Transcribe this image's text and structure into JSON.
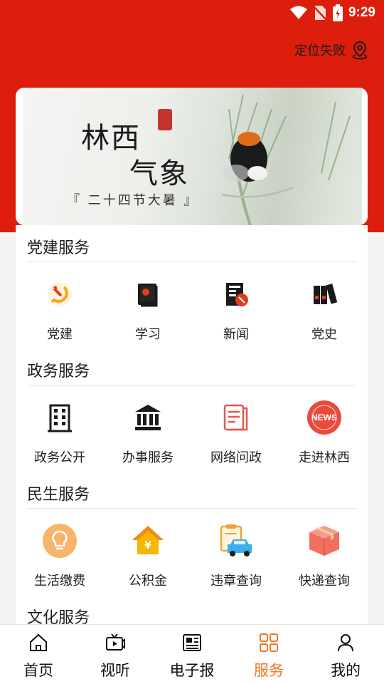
{
  "status_bar": {
    "time": "9:29"
  },
  "location": {
    "text": "定位失败",
    "icon": "location-pin-icon"
  },
  "banner": {
    "title_line1": "林西",
    "title_line2": "气象",
    "subtitle": "『 二十四节大暑 』"
  },
  "sections": [
    {
      "title": "党建服务",
      "items": [
        {
          "label": "党建",
          "icon": "hammer-sickle-icon"
        },
        {
          "label": "学习",
          "icon": "book-icon"
        },
        {
          "label": "新闻",
          "icon": "news-doc-icon"
        },
        {
          "label": "党史",
          "icon": "binders-icon"
        }
      ]
    },
    {
      "title": "政务服务",
      "items": [
        {
          "label": "政务公开",
          "icon": "building-icon"
        },
        {
          "label": "办事服务",
          "icon": "bank-icon"
        },
        {
          "label": "网络问政",
          "icon": "document-icon"
        },
        {
          "label": "走进林西",
          "icon": "news-globe-icon",
          "badge": "NEWS"
        }
      ]
    },
    {
      "title": "民生服务",
      "items": [
        {
          "label": "生活缴费",
          "icon": "lightbulb-icon"
        },
        {
          "label": "公积金",
          "icon": "house-yen-icon",
          "badge": "¥"
        },
        {
          "label": "违章查询",
          "icon": "car-clipboard-icon"
        },
        {
          "label": "快递查询",
          "icon": "package-icon"
        }
      ]
    },
    {
      "title": "文化服务",
      "items": []
    }
  ],
  "tabbar": {
    "tabs": [
      {
        "label": "首页",
        "icon": "home-icon"
      },
      {
        "label": "视听",
        "icon": "tv-icon"
      },
      {
        "label": "电子报",
        "icon": "newspaper-icon"
      },
      {
        "label": "服务",
        "icon": "grid-icon",
        "active": true
      },
      {
        "label": "我的",
        "icon": "person-icon"
      }
    ]
  },
  "colors": {
    "header_red": "#dd1e0c",
    "active_tab": "#ee7722"
  }
}
